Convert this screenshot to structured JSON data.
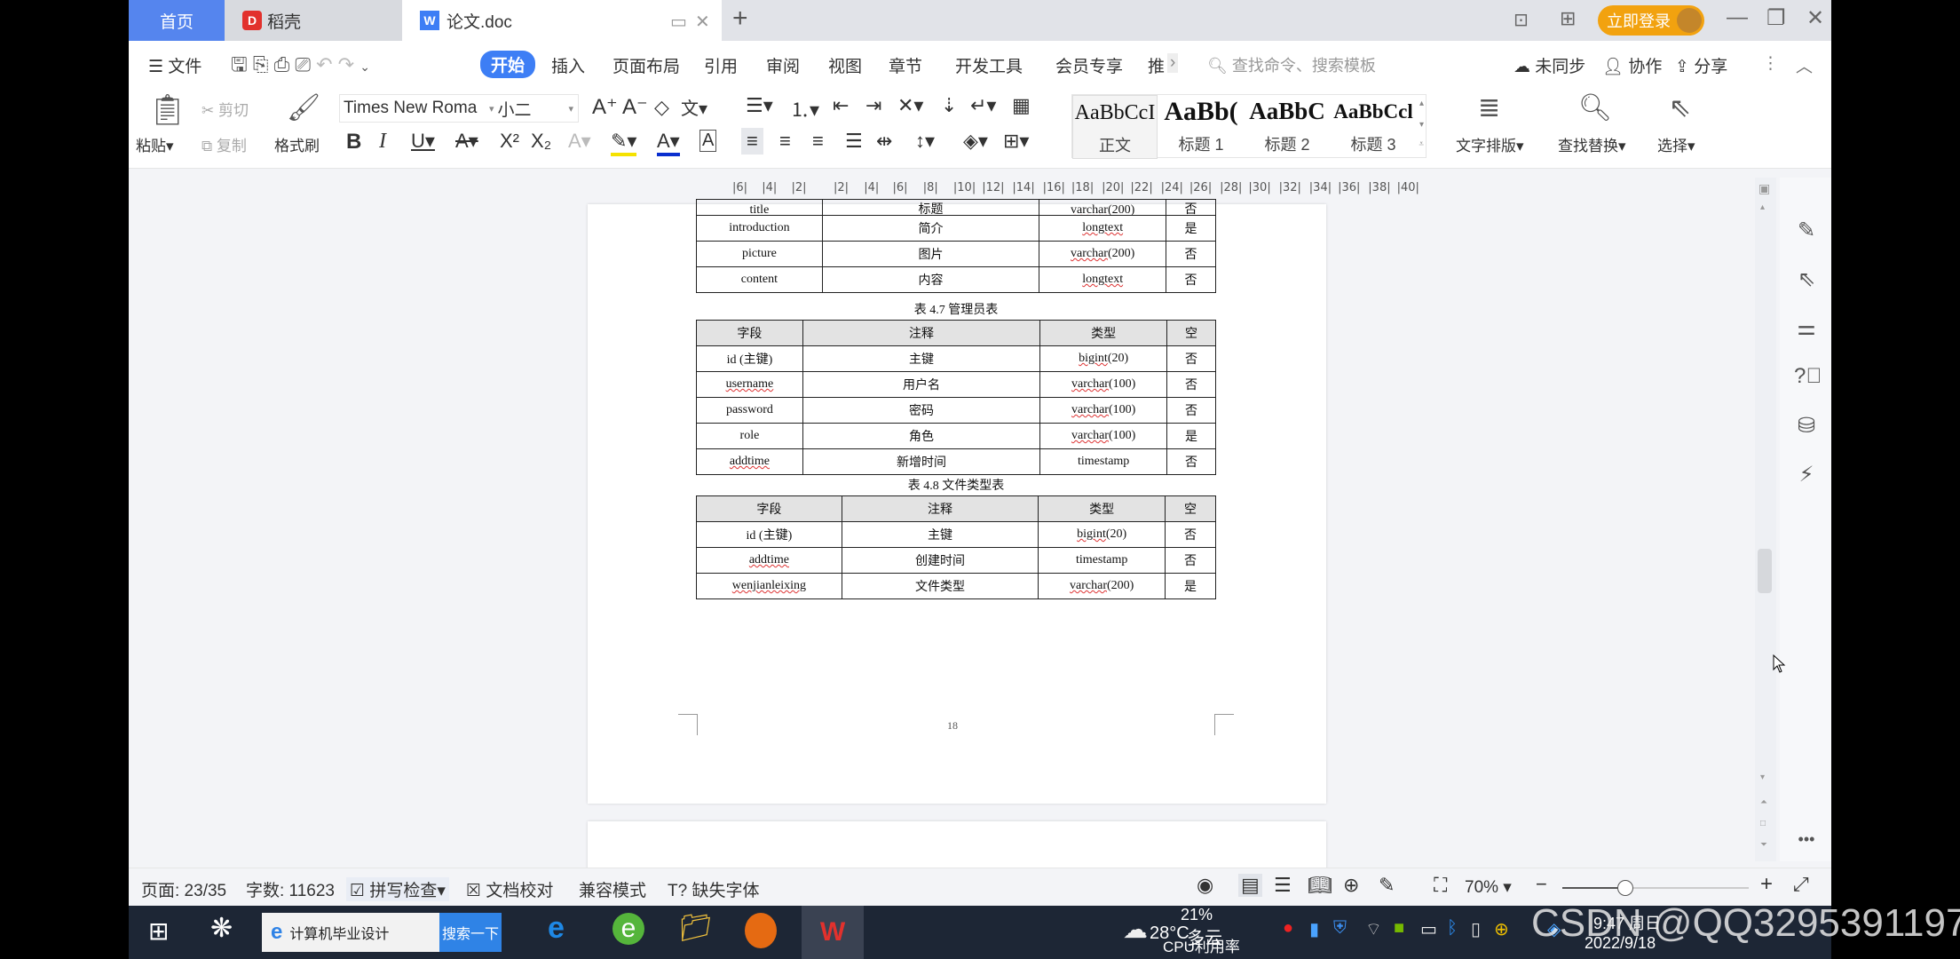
{
  "titlebar": {
    "tabs": [
      {
        "label": "首页",
        "active": false
      },
      {
        "label": "稻壳",
        "active": false
      },
      {
        "label": "论文.doc",
        "active": true
      }
    ],
    "login_label": "立即登录"
  },
  "menu": {
    "file_label": "文件",
    "tabs": [
      "开始",
      "插入",
      "页面布局",
      "引用",
      "审阅",
      "视图",
      "章节",
      "开发工具",
      "会员专享",
      "推"
    ],
    "active_tab": "开始",
    "search_placeholder": "查找命令、搜索模板",
    "sync_label": "未同步",
    "collab_label": "协作",
    "share_label": "分享"
  },
  "toolbar": {
    "paste_label": "粘贴",
    "cut_label": "剪切",
    "copy_label": "复制",
    "format_painter_label": "格式刷",
    "font_name": "Times New Roma",
    "font_size": "小二",
    "styles": [
      {
        "preview": "AaBbCcI",
        "label": "正文"
      },
      {
        "preview": "AaBb(",
        "label": "标题 1"
      },
      {
        "preview": "AaBbC",
        "label": "标题 2"
      },
      {
        "preview": "AaBbCcl",
        "label": "标题 3"
      }
    ],
    "text_layout_label": "文字排版",
    "find_replace_label": "查找替换",
    "select_label": "选择"
  },
  "ruler": {
    "ticks": [
      "6",
      "4",
      "2",
      "2",
      "4",
      "6",
      "8",
      "10",
      "12",
      "14",
      "16",
      "18",
      "20",
      "22",
      "24",
      "26",
      "28",
      "30",
      "32",
      "34",
      "36",
      "38",
      "40"
    ]
  },
  "document": {
    "table_prev": {
      "rows": [
        [
          "title",
          "标题",
          "varchar(200)",
          "否"
        ],
        [
          "introduction",
          "简介",
          "longtext",
          "是"
        ],
        [
          "picture",
          "图片",
          "varchar(200)",
          "否"
        ],
        [
          "content",
          "内容",
          "longtext",
          "否"
        ]
      ]
    },
    "table_4_7": {
      "caption": "表 4.7  管理员表",
      "headers": [
        "字段",
        "注释",
        "类型",
        "空"
      ],
      "rows": [
        [
          "id (主键)",
          "主键",
          "bigint(20)",
          "否"
        ],
        [
          "username",
          "用户名",
          "varchar(100)",
          "否"
        ],
        [
          "password",
          "密码",
          "varchar(100)",
          "否"
        ],
        [
          "role",
          "角色",
          "varchar(100)",
          "是"
        ],
        [
          "addtime",
          "新增时间",
          "timestamp",
          "否"
        ]
      ]
    },
    "table_4_8": {
      "caption": "表 4.8  文件类型表",
      "headers": [
        "字段",
        "注释",
        "类型",
        "空"
      ],
      "rows": [
        [
          "id (主键)",
          "主键",
          "bigint(20)",
          "否"
        ],
        [
          "addtime",
          "创建时间",
          "timestamp",
          "否"
        ],
        [
          "wenjianleixing",
          "文件类型",
          "varchar(200)",
          "是"
        ]
      ]
    },
    "page_number": "18"
  },
  "statusbar": {
    "page": "页面: 23/35",
    "word_count": "字数: 11623",
    "spell_check": "拼写检查",
    "doc_proof": "文档校对",
    "compat_mode": "兼容模式",
    "missing_font": "缺失字体",
    "zoom": "70%",
    "zoom_fraction": 0.7
  },
  "taskbar": {
    "search_text": "计算机毕业设计",
    "search_button": "搜索一下",
    "weather_temp": "28°C",
    "weather_desc": "多云",
    "cpu_percent": "21%",
    "cpu_label": "CPU利用率",
    "time": "9:47 周日",
    "date": "2022/9/18"
  },
  "watermark": "CSDN @QQ3295391197",
  "colors": {
    "accent": "#3d7ef5",
    "home_tab": "#5585ee",
    "login": "#f2a20f",
    "taskbar": "#1d2635"
  }
}
